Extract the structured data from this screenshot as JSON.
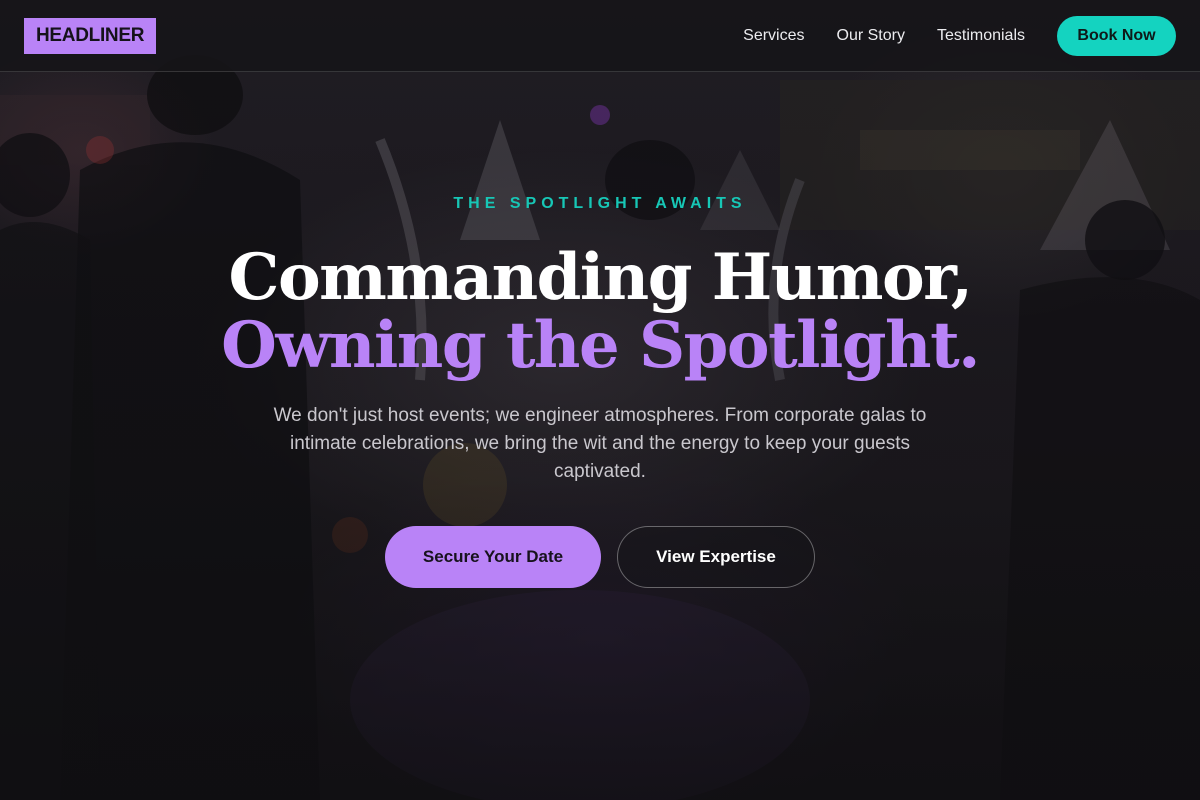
{
  "nav": {
    "logo": "HEADLINER",
    "links": [
      "Services",
      "Our Story",
      "Testimonials"
    ],
    "cta": "Book Now"
  },
  "hero": {
    "eyebrow": "THE SPOTLIGHT AWAITS",
    "headline_line1": "Commanding Humor,",
    "headline_line2": "Owning the Spotlight.",
    "subtext": "We don't just host events; we engineer atmospheres. From corporate galas to intimate celebrations, we bring the wit and the energy to keep your guests captivated.",
    "primary_cta": "Secure Your Date",
    "secondary_cta": "View Expertise"
  },
  "colors": {
    "accent_purple": "#b983f7",
    "accent_teal": "#14d3c0",
    "background": "#161418"
  }
}
